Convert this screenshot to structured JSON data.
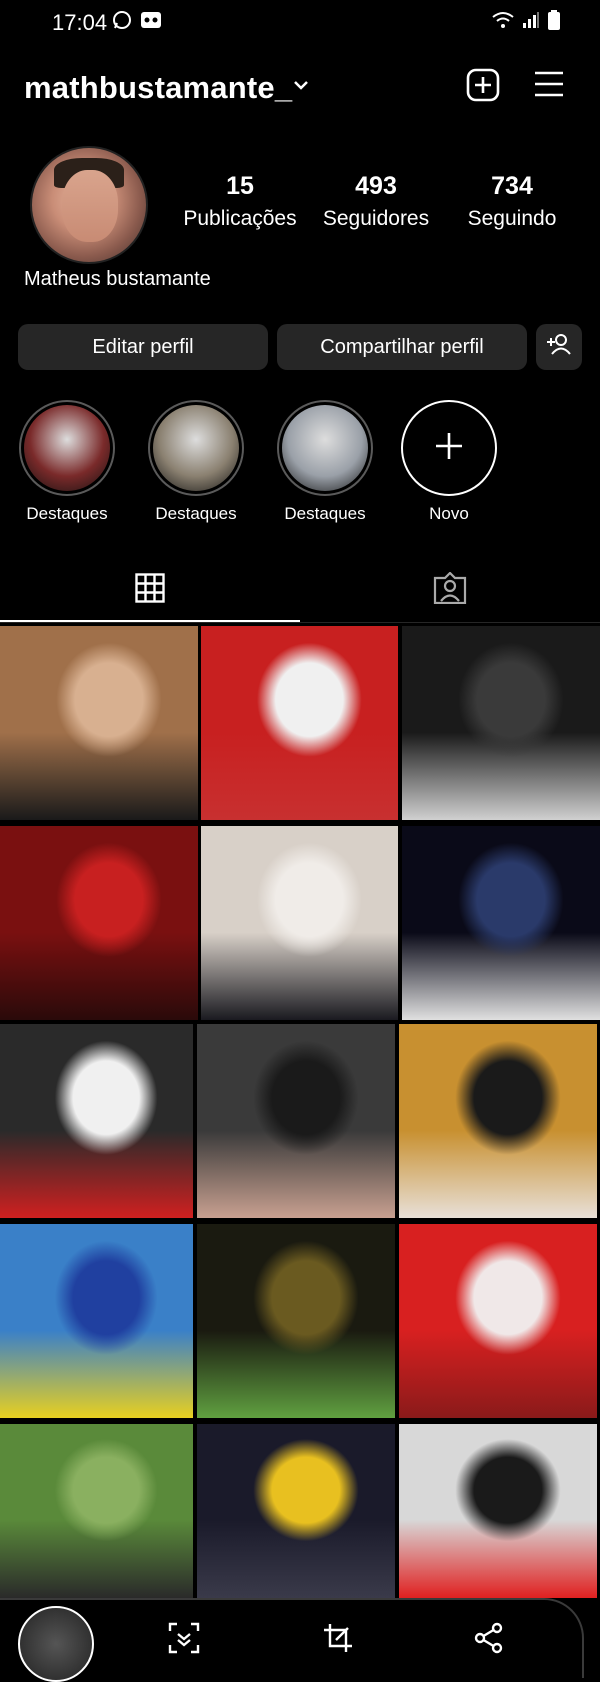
{
  "status_bar": {
    "time": "17:04"
  },
  "profile": {
    "username": "mathbustamante_",
    "full_name": "Matheus bustamante",
    "stats": [
      {
        "value": "15",
        "label": "Publicações"
      },
      {
        "value": "493",
        "label": "Seguidores"
      },
      {
        "value": "734",
        "label": "Seguindo"
      }
    ]
  },
  "buttons": {
    "edit": "Editar perfil",
    "share": "Compartilhar perfil"
  },
  "highlights": [
    {
      "label": "Destaques",
      "color": "#7a2a2a"
    },
    {
      "label": "Destaques",
      "color": "#8a8070"
    },
    {
      "label": "Destaques",
      "color": "#9aa0a8"
    }
  ],
  "new_highlight": {
    "label": "Novo"
  },
  "tabs": [
    {
      "name": "posts-grid",
      "icon": "grid-icon",
      "active": true
    },
    {
      "name": "tagged",
      "icon": "tagged-person-icon",
      "active": false
    }
  ],
  "grid_posts": [
    {
      "colors": [
        "#a0704a",
        "#d8b090",
        "#1a1a1a"
      ]
    },
    {
      "colors": [
        "#c82020",
        "#f0f0f0",
        "#c83030"
      ]
    },
    {
      "colors": [
        "#1a1a1a",
        "#3a3a3a",
        "#d0d0d0"
      ]
    },
    {
      "colors": [
        "#7a1010",
        "#c82020",
        "#2a0a0a"
      ]
    },
    {
      "colors": [
        "#d8d0c8",
        "#f0ece8",
        "#1a1a20"
      ]
    },
    {
      "colors": [
        "#0a0a18",
        "#2a3a6a",
        "#e0e0e0"
      ]
    },
    {
      "colors": [
        "#2a2a2a",
        "#f0f0f0",
        "#d02020"
      ]
    },
    {
      "colors": [
        "#3a3a3a",
        "#1a1a1a",
        "#c8a090"
      ]
    },
    {
      "colors": [
        "#c89030",
        "#1a1a1a",
        "#e8e0d8"
      ]
    },
    {
      "colors": [
        "#3a80c8",
        "#2040a0",
        "#e8d020"
      ]
    },
    {
      "colors": [
        "#1a1a10",
        "#6a5a20",
        "#60a040"
      ]
    },
    {
      "colors": [
        "#d82020",
        "#f0e8e8",
        "#8a1a1a"
      ]
    },
    {
      "colors": [
        "#5a8a3a",
        "#8ab060",
        "#2a2a2a"
      ]
    },
    {
      "colors": [
        "#1a1a2a",
        "#e8c020",
        "#3a3a4a"
      ]
    },
    {
      "colors": [
        "#d8d8d8",
        "#1a1a1a",
        "#e02020"
      ]
    }
  ]
}
